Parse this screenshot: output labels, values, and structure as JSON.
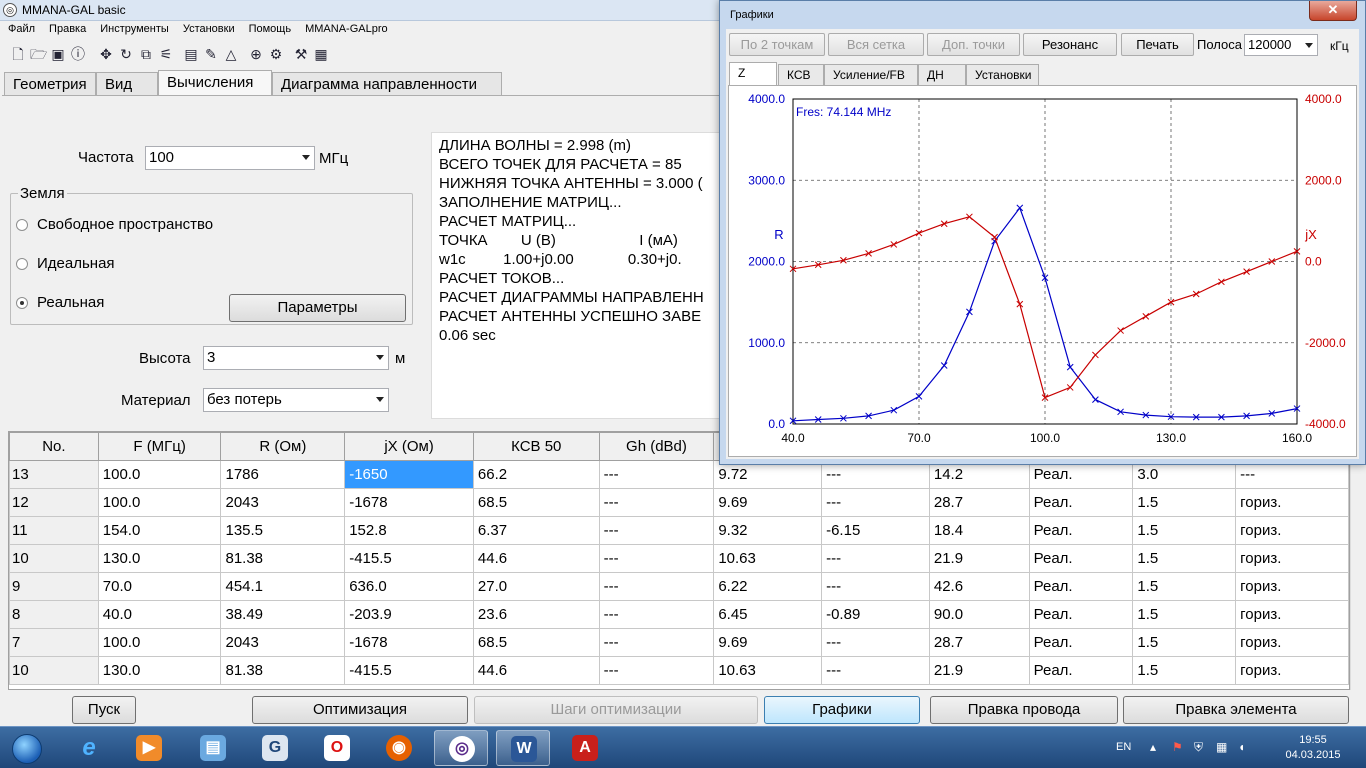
{
  "main": {
    "title": "MMANA-GAL basic",
    "menu": [
      "Файл",
      "Правка",
      "Инструменты",
      "Установки",
      "Помощь",
      "MMANA-GALpro"
    ],
    "tabs": [
      "Геометрия",
      "Вид",
      "Вычисления",
      "Диаграмма направленности"
    ],
    "active_tab": "Вычисления"
  },
  "calc": {
    "freq_label": "Частота",
    "freq_value": "100",
    "freq_unit": "МГц",
    "ground_label": "Земля",
    "ground_free": "Свободное пространство",
    "ground_ideal": "Идеальная",
    "ground_real": "Реальная",
    "ground_selected": "Реальная",
    "params_button": "Параметры",
    "height_label": "Высота",
    "height_value": "3",
    "height_unit": "м",
    "material_label": "Материал",
    "material_value": "без потерь"
  },
  "log_lines": [
    "ДЛИНА ВОЛНЫ = 2.998 (m)",
    "ВСЕГО ТОЧЕК ДЛЯ РАСЧЕТА = 85",
    "НИЖНЯЯ ТОЧКА АНТЕННЫ = 3.000 (",
    "ЗАПОЛНЕНИЕ МАТРИЦ...",
    "РАСЧЕТ МАТРИЦ...",
    "ТОЧКА        U (В)                    I (мА)",
    "w1c         1.00+j0.00             0.30+j0.",
    "РАСЧЕТ ТОКОВ...",
    "РАСЧЕТ ДИАГРАММЫ НАПРАВЛЕНН",
    "РАСЧЕТ АНТЕННЫ УСПЕШНО ЗАВЕ",
    "0.06 sec"
  ],
  "table": {
    "headers": [
      "No.",
      "F (МГц)",
      "R (Ом)",
      "jX (Ом)",
      "КСВ 50",
      "Gh (dBd)",
      "",
      "",
      "",
      "",
      "",
      ""
    ],
    "rows": [
      [
        "13",
        "100.0",
        "1786",
        "-1650",
        "66.2",
        "---",
        "9.72",
        "---",
        "14.2",
        "Реал.",
        "3.0",
        "---"
      ],
      [
        "12",
        "100.0",
        "2043",
        "-1678",
        "68.5",
        "---",
        "9.69",
        "---",
        "28.7",
        "Реал.",
        "1.5",
        "гориз."
      ],
      [
        "11",
        "154.0",
        "135.5",
        "152.8",
        "6.37",
        "---",
        "9.32",
        "-6.15",
        "18.4",
        "Реал.",
        "1.5",
        "гориз."
      ],
      [
        "10",
        "130.0",
        "81.38",
        "-415.5",
        "44.6",
        "---",
        "10.63",
        "---",
        "21.9",
        "Реал.",
        "1.5",
        "гориз."
      ],
      [
        "9",
        "70.0",
        "454.1",
        "636.0",
        "27.0",
        "---",
        "6.22",
        "---",
        "42.6",
        "Реал.",
        "1.5",
        "гориз."
      ],
      [
        "8",
        "40.0",
        "38.49",
        "-203.9",
        "23.6",
        "---",
        "6.45",
        "-0.89",
        "90.0",
        "Реал.",
        "1.5",
        "гориз."
      ],
      [
        "7",
        "100.0",
        "2043",
        "-1678",
        "68.5",
        "---",
        "9.69",
        "---",
        "28.7",
        "Реал.",
        "1.5",
        "гориз."
      ],
      [
        "10",
        "130.0",
        "81.38",
        "-415.5",
        "44.6",
        "---",
        "10.63",
        "---",
        "21.9",
        "Реал.",
        "1.5",
        "гориз."
      ]
    ]
  },
  "bottom_buttons": [
    "Пуск",
    "Оптимизация",
    "Шаги оптимизации",
    "Графики",
    "Правка провода",
    "Правка элемента"
  ],
  "graph_window": {
    "title": "Графики",
    "close_glyph": "✕",
    "buttons": [
      "По 2 точкам",
      "Вся сетка",
      "Доп. точки",
      "Резонанс",
      "Печать"
    ],
    "band_label": "Полоса",
    "band_value": "120000",
    "band_unit": "кГц",
    "tabs": [
      "Z",
      "КСВ",
      "Усиление/FB",
      "ДН",
      "Установки"
    ],
    "active_tab": "Z"
  },
  "chart_data": {
    "type": "line",
    "annotation": "Fres: 74.144 MHz",
    "xlabel": "",
    "ylabel_left": "R",
    "ylabel_right": "jX",
    "xlim": [
      40,
      160
    ],
    "ylim_left": [
      0,
      4000
    ],
    "ylim_right": [
      -4000,
      4000
    ],
    "x_ticks": [
      "40.0",
      "70.0",
      "100.0",
      "130.0",
      "160.0"
    ],
    "y_ticks_left": [
      "4000.0",
      "3000.0",
      "2000.0",
      "1000.0",
      "0.0"
    ],
    "y_ticks_right": [
      "4000.0",
      "2000.0",
      "0.0",
      "-2000.0",
      "-4000.0"
    ],
    "grid": true,
    "colors": {
      "R": "#0000c8",
      "jX": "#c80000"
    },
    "x": [
      40,
      46,
      52,
      58,
      64,
      70,
      76,
      82,
      88,
      94,
      100,
      106,
      112,
      118,
      124,
      130,
      136,
      142,
      148,
      154,
      160
    ],
    "series": [
      {
        "axis": "left",
        "values": [
          40,
          55,
          70,
          100,
          170,
          340,
          720,
          1380,
          2250,
          2660,
          1800,
          700,
          300,
          150,
          110,
          90,
          85,
          85,
          100,
          130,
          190
        ]
      },
      {
        "axis": "right",
        "values": [
          -180,
          -80,
          30,
          200,
          420,
          700,
          930,
          1100,
          600,
          -1050,
          -3350,
          -3100,
          -2300,
          -1700,
          -1350,
          -1000,
          -800,
          -500,
          -250,
          0,
          250
        ]
      }
    ]
  },
  "taskbar": {
    "lang": "EN",
    "time": "19:55",
    "date": "04.03.2015"
  }
}
